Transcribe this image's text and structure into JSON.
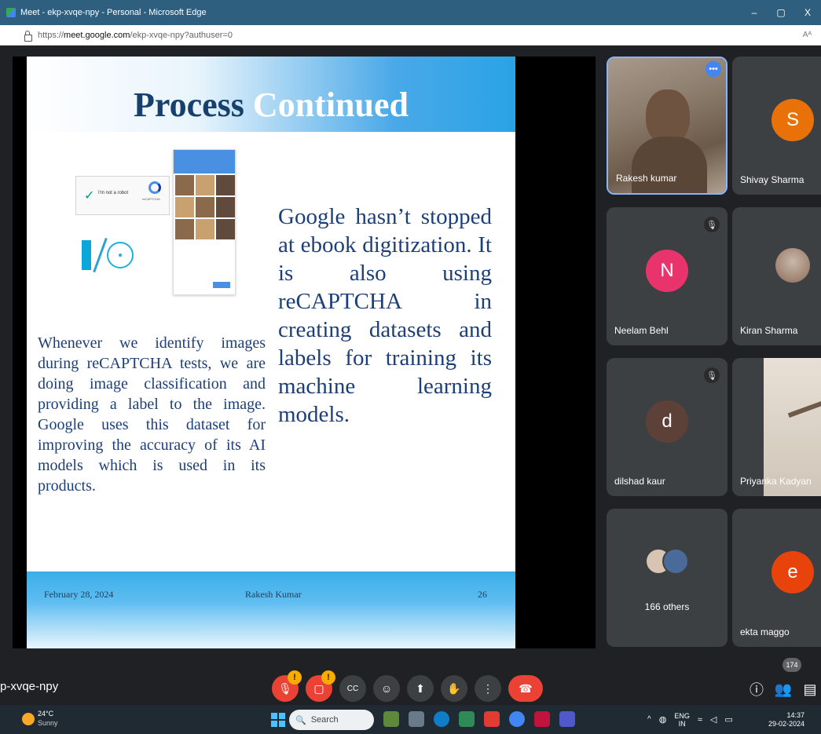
{
  "window": {
    "title": "Meet - ekp-xvqe-npy - Personal - Microsoft Edge",
    "controls": [
      "–",
      "▢",
      "X"
    ]
  },
  "address": {
    "prefix": "https://",
    "domain": "meet.google.com",
    "path": "/ekp-xvqe-npy?authuser=0",
    "read_aloud": "Aᴬ"
  },
  "slide": {
    "title_dark": "Process ",
    "title_light": "Continued",
    "left_paragraph": "Whenever we identify images during reCAPTCHA tests, we are doing image classification and providing a label to the image. Google uses this dataset for improving the accuracy of its AI models which is used in its products.",
    "right_paragraph": "Google hasn’t stopped at ebook digitization. It is also using reCAPTCHA in creating datasets and labels for training its machine learning models.",
    "captcha_label": "I'm not a robot",
    "captcha_brand": "reCAPTCHA",
    "footer_date": "February 28, 2024",
    "footer_author": "Rakesh Kumar",
    "footer_page": "26"
  },
  "participants": [
    {
      "name": "Rakesh kumar",
      "type": "video"
    },
    {
      "name": "Shivay Sharma",
      "initial": "S",
      "color": "#e8710a"
    },
    {
      "name": "Neelam Behl",
      "initial": "N",
      "color": "#e8336d",
      "muted": true
    },
    {
      "name": "Kiran Sharma",
      "type": "video"
    },
    {
      "name": "dilshad kaur",
      "initial": "d",
      "color": "#5d4037",
      "muted": true
    },
    {
      "name": "Priyanka Kadyan",
      "type": "video"
    },
    {
      "name": "166 others",
      "type": "group"
    },
    {
      "name": "ekta maggo",
      "initial": "e",
      "color": "#e8430a"
    }
  ],
  "meeting": {
    "code": "p-xvqe-npy",
    "participant_count": "174",
    "warning_badge": "!"
  },
  "controls": {
    "mic_icon": "mic-off-icon",
    "cam_icon": "camera-off-icon",
    "cc_icon": "captions-icon",
    "emoji_icon": "emoji-icon",
    "present_icon": "present-icon",
    "hand_icon": "raise-hand-icon",
    "more_icon": "more-options-icon",
    "end_icon": "end-call-icon"
  },
  "taskbar": {
    "temp": "24°C",
    "condition": "Sunny",
    "search_label": "Search",
    "lang_top": "ENG",
    "lang_bottom": "IN",
    "time": "14:37",
    "date": "29-02-2024"
  },
  "colors": {
    "meet_bg": "#202124",
    "tile_bg": "#3c4043",
    "danger": "#ea4335",
    "warning": "#f9ab00",
    "accent": "#4285f4"
  }
}
